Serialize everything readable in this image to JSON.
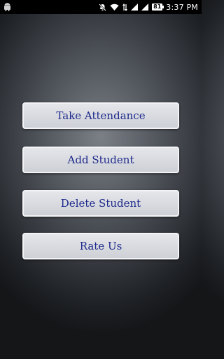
{
  "status_bar": {
    "battery_level": "81",
    "time": "3:37 PM",
    "icons": [
      "android-icon",
      "mute-icon",
      "wifi-icon",
      "data-icon",
      "signal-icon",
      "signal-icon",
      "battery-icon"
    ]
  },
  "menu": {
    "take_attendance": "Take Attendance",
    "add_student": "Add Student",
    "delete_student": "Delete Student",
    "rate_us": "Rate Us"
  },
  "colors": {
    "button_text": "#1f2a8c",
    "button_face": "#d8dadf",
    "background_center": "#7b7f86",
    "background_edge": "#141618"
  }
}
